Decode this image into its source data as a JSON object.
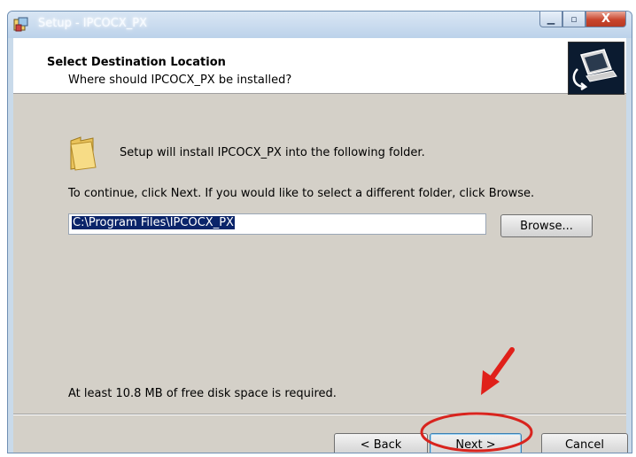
{
  "window": {
    "title": "Setup - IPCOCX_PX",
    "icons": {
      "app": "setup-app-icon",
      "minimize": "minimize-icon",
      "maximize": "maximize-icon",
      "close": "close-icon"
    },
    "close_glyph": "X"
  },
  "header": {
    "title": "Select Destination Location",
    "subtitle": "Where should IPCOCX_PX be installed?",
    "image": "computer-install-graphic"
  },
  "body": {
    "folder_icon": "folder-icon",
    "intro_text": "Setup will install IPCOCX_PX into the following folder.",
    "instruction_text": "To continue, click Next. If you would like to select a different folder, click Browse.",
    "path_value": "C:\\Program Files\\IPCOCX_PX",
    "browse_label": "Browse...",
    "disk_space_text": "At least 10.8 MB of free disk space is required."
  },
  "footer": {
    "back_label": "< Back",
    "next_label": "Next >",
    "cancel_label": "Cancel"
  },
  "annotation": {
    "arrow_color": "#e0201a",
    "circle_color": "#d8241e",
    "highlights": "next-button"
  }
}
